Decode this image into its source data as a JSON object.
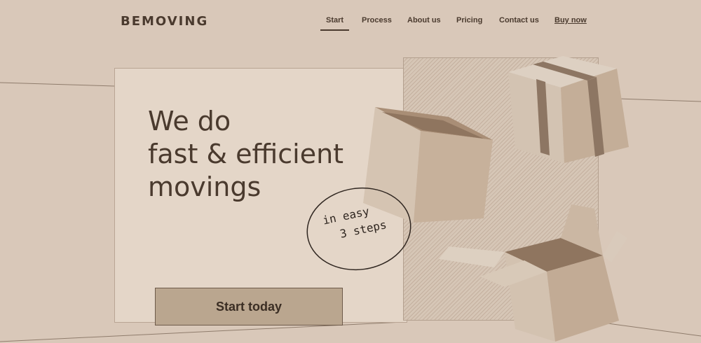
{
  "header": {
    "logo": "BEMOVING",
    "nav": [
      {
        "label": "Start"
      },
      {
        "label": "Process"
      },
      {
        "label": "About us"
      },
      {
        "label": "Pricing"
      },
      {
        "label": "Contact us"
      },
      {
        "label": "Buy now"
      }
    ],
    "active_item": "Start"
  },
  "hero": {
    "headline": [
      "We do",
      "fast & efficient",
      "movings"
    ],
    "handwritten_note": [
      "in easy",
      "3 steps"
    ],
    "cta_label": "Start today"
  },
  "colors": {
    "background": "#d9c8b9",
    "card": "#e4d6c8",
    "text": "#4a3a2e",
    "button": "#baa68f",
    "cardboard": "#c9b49f"
  }
}
